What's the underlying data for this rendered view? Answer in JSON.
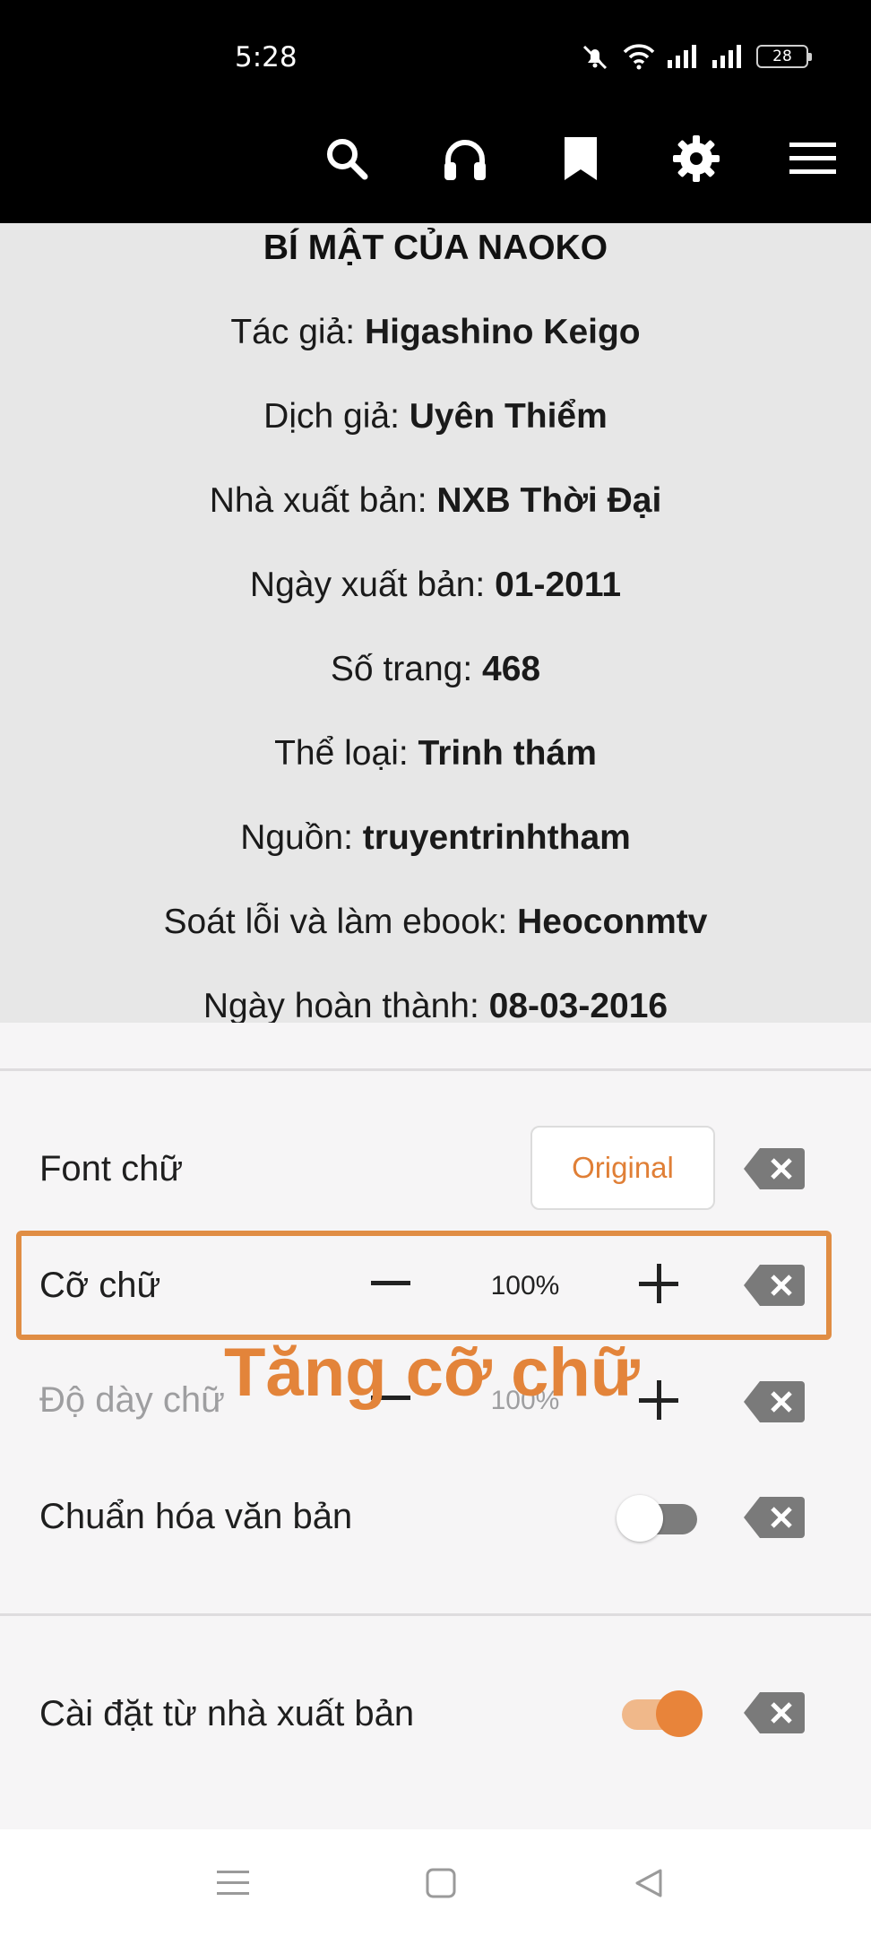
{
  "status": {
    "time": "5:28",
    "battery": "28"
  },
  "toolbar": {
    "icons": [
      "search-icon",
      "headphones-icon",
      "bookmark-icon",
      "gear-icon",
      "menu-icon"
    ]
  },
  "book": {
    "title": "BÍ MẬT CỦA NAOKO",
    "info": [
      {
        "label": "Tác giả: ",
        "value": "Higashino Keigo"
      },
      {
        "label": "Dịch giả: ",
        "value": "Uyên Thiểm"
      },
      {
        "label": "Nhà xuất bản: ",
        "value": "NXB Thời Đại"
      },
      {
        "label": "Ngày xuất bản: ",
        "value": "01-2011"
      },
      {
        "label": "Số trang: ",
        "value": "468"
      },
      {
        "label": "Thể loại: ",
        "value": "Trinh thám"
      },
      {
        "label": "Nguồn: ",
        "value": "truyentrinhtham"
      },
      {
        "label": "Soát lỗi và làm ebook: ",
        "value": "Heoconmtv"
      },
      {
        "label": "Ngày hoàn thành: ",
        "value": "08-03-2016"
      }
    ]
  },
  "settings": {
    "font": {
      "label": "Font chữ",
      "value": "Original"
    },
    "font_size": {
      "label": "Cỡ chữ",
      "value": "100%",
      "minus": "−",
      "plus": "+"
    },
    "font_weight": {
      "label": "Độ dày chữ",
      "value": "100%",
      "minus": "−",
      "plus": "+"
    },
    "normalize": {
      "label": "Chuẩn hóa văn bản",
      "enabled": false
    },
    "publisher": {
      "label": "Cài đặt từ nhà xuất bản",
      "enabled": true
    },
    "accent_color": "#e8843a"
  },
  "annotation": {
    "text": "Tăng cỡ chữ",
    "color": "#e3843a"
  },
  "navbar": {
    "icons": [
      "recents-icon",
      "home-icon",
      "back-icon"
    ]
  }
}
